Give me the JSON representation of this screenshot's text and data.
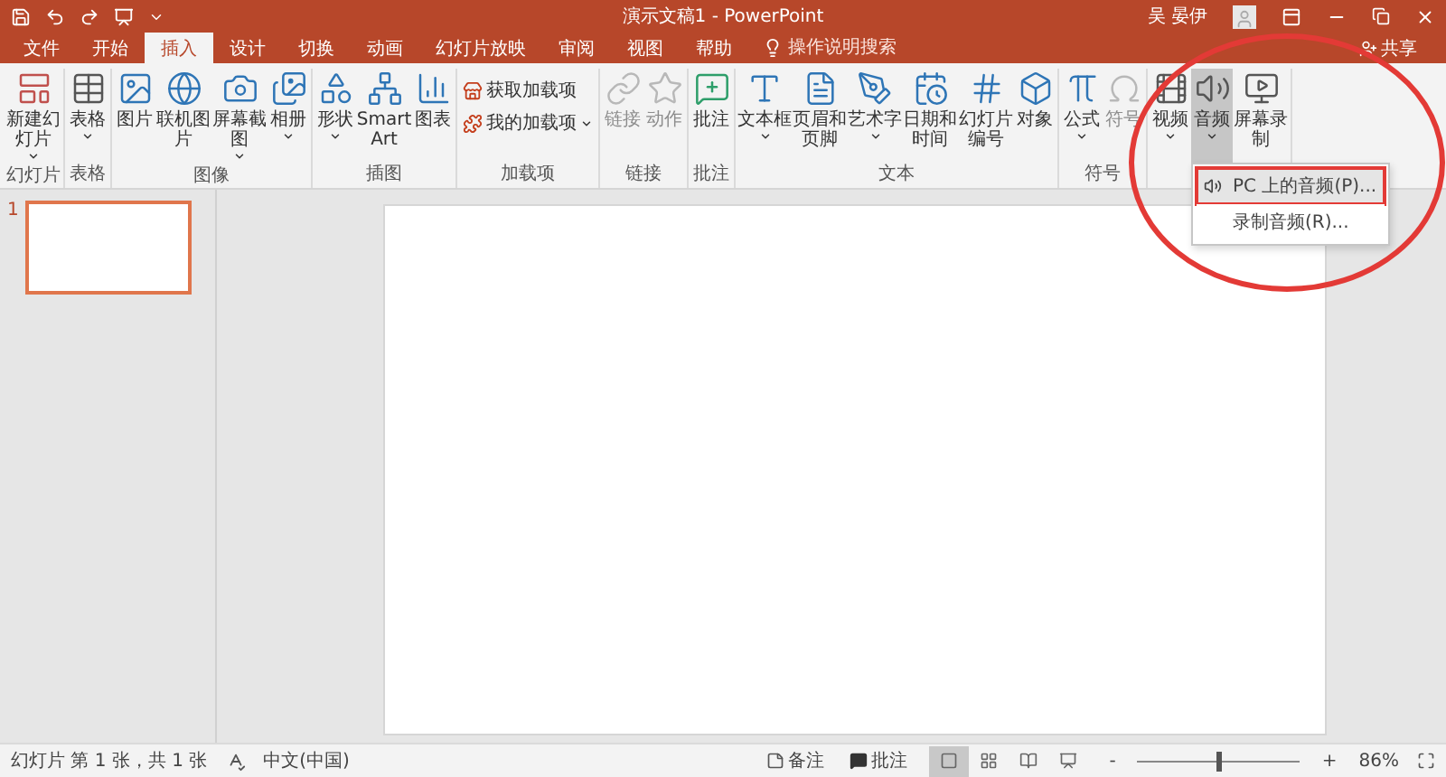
{
  "title_bar": {
    "title": "演示文稿1 - PowerPoint",
    "user": "吴 晏伊"
  },
  "tabs": [
    {
      "label": "文件",
      "selected": false
    },
    {
      "label": "开始",
      "selected": false
    },
    {
      "label": "插入",
      "selected": true
    },
    {
      "label": "设计",
      "selected": false
    },
    {
      "label": "切换",
      "selected": false
    },
    {
      "label": "动画",
      "selected": false
    },
    {
      "label": "幻灯片放映",
      "selected": false
    },
    {
      "label": "审阅",
      "selected": false
    },
    {
      "label": "视图",
      "selected": false
    },
    {
      "label": "帮助",
      "selected": false
    }
  ],
  "search": {
    "placeholder": "操作说明搜索"
  },
  "share": "共享",
  "ribbon": {
    "groups": [
      {
        "label": "幻灯片",
        "buttons": [
          {
            "kind": "large",
            "label": "新建幻灯片",
            "menu": true,
            "disabled": false,
            "pressed": false
          }
        ]
      },
      {
        "label": "表格",
        "buttons": [
          {
            "kind": "large",
            "label": "表格",
            "menu": true,
            "disabled": false,
            "pressed": false
          }
        ]
      },
      {
        "label": "图像",
        "buttons": [
          {
            "kind": "large",
            "label": "图片",
            "menu": false,
            "disabled": false,
            "pressed": false
          },
          {
            "kind": "large",
            "label": "联机图片",
            "menu": false,
            "disabled": false,
            "pressed": false
          },
          {
            "kind": "large",
            "label": "屏幕截图",
            "menu": true,
            "disabled": false,
            "pressed": false
          },
          {
            "kind": "large",
            "label": "相册",
            "menu": true,
            "disabled": false,
            "pressed": false
          }
        ]
      },
      {
        "label": "插图",
        "buttons": [
          {
            "kind": "large",
            "label": "形状",
            "menu": true,
            "disabled": false,
            "pressed": false
          },
          {
            "kind": "large",
            "label": "SmartArt",
            "menu": false,
            "disabled": false,
            "pressed": false
          },
          {
            "kind": "large",
            "label": "图表",
            "menu": false,
            "disabled": false,
            "pressed": false
          }
        ]
      },
      {
        "label": "加载项",
        "buttons": [
          {
            "kind": "small",
            "label": "获取加载项",
            "menu": false,
            "disabled": false,
            "pressed": false
          },
          {
            "kind": "small",
            "label": "我的加载项",
            "menu": true,
            "disabled": false,
            "pressed": false
          }
        ]
      },
      {
        "label": "链接",
        "buttons": [
          {
            "kind": "large",
            "label": "链接",
            "menu": false,
            "disabled": true,
            "pressed": false
          },
          {
            "kind": "large",
            "label": "动作",
            "menu": false,
            "disabled": true,
            "pressed": false
          }
        ]
      },
      {
        "label": "批注",
        "buttons": [
          {
            "kind": "large",
            "label": "批注",
            "menu": false,
            "disabled": false,
            "pressed": false
          }
        ]
      },
      {
        "label": "文本",
        "buttons": [
          {
            "kind": "large",
            "label": "文本框",
            "menu": true,
            "disabled": false,
            "pressed": false
          },
          {
            "kind": "large",
            "label": "页眉和页脚",
            "menu": false,
            "disabled": false,
            "pressed": false
          },
          {
            "kind": "large",
            "label": "艺术字",
            "menu": true,
            "disabled": false,
            "pressed": false
          },
          {
            "kind": "large",
            "label": "日期和时间",
            "menu": false,
            "disabled": false,
            "pressed": false
          },
          {
            "kind": "large",
            "label": "幻灯片编号",
            "menu": false,
            "disabled": false,
            "pressed": false
          },
          {
            "kind": "large",
            "label": "对象",
            "menu": false,
            "disabled": false,
            "pressed": false
          }
        ]
      },
      {
        "label": "符号",
        "buttons": [
          {
            "kind": "large",
            "label": "公式",
            "menu": true,
            "disabled": false,
            "pressed": false
          },
          {
            "kind": "large",
            "label": "符号",
            "menu": false,
            "disabled": true,
            "pressed": false
          }
        ]
      },
      {
        "buttons": [
          {
            "kind": "large",
            "label": "视频",
            "menu": true,
            "disabled": false,
            "pressed": false
          },
          {
            "kind": "large",
            "label": "音频",
            "menu": true,
            "disabled": false,
            "pressed": true,
            "dropdown": [
              {
                "label": "PC 上的音频(P)...",
                "selected": true
              },
              {
                "label": "录制音频(R)...",
                "selected": false
              }
            ]
          },
          {
            "kind": "large",
            "label": "屏幕录制",
            "menu": false,
            "disabled": false,
            "pressed": false
          }
        ]
      }
    ]
  },
  "slides": [
    {
      "number": "1",
      "selected": true
    }
  ],
  "status_bar": {
    "slide_info": "幻灯片 第 1 张，共 1 张",
    "language": "中文(中国)",
    "notes": "备注",
    "comments": "批注",
    "views": [
      {
        "selected": true
      },
      {
        "selected": false
      },
      {
        "selected": false
      },
      {
        "selected": false
      }
    ],
    "zoom": {
      "minus": "-",
      "plus": "+",
      "level": 0.5,
      "reading": "86%"
    }
  }
}
